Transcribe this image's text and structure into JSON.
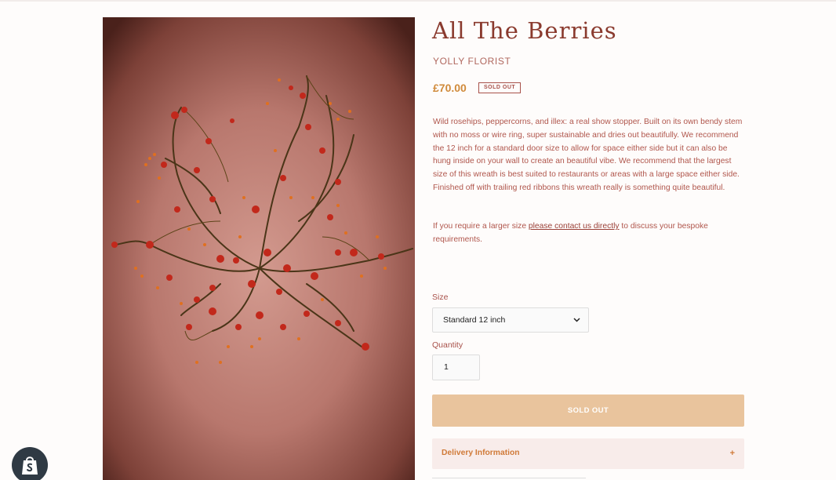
{
  "product": {
    "title": "All The Berries",
    "vendor": "YOLLY FLORIST",
    "price": "£70.00",
    "badge": "SOLD OUT",
    "description": "Wild rosehips, peppercorns, and illex: a real show stopper. Built on its own bendy stem with no moss or wire ring, super sustainable and dries out beautifully. We recommend the 12 inch for a standard door size to allow for space either side but it can also be hung inside on your wall to create an beautiful vibe. We recommend that the largest size of this wreath is best suited to restaurants or areas with a large space either side. Finished off with trailing red ribbons this wreath really is something quite beautiful.",
    "contact_prefix": "If you require a larger size ",
    "contact_link": "please contact us directly",
    "contact_suffix": " to discuss your bespoke requirements."
  },
  "form": {
    "size_label": "Size",
    "size_value": "Standard 12 inch",
    "quantity_label": "Quantity",
    "quantity_value": "1",
    "button_label": "SOLD OUT"
  },
  "accordion": {
    "title": "Delivery Information",
    "icon": "+"
  },
  "icons": {
    "select": "chevron-down-icon",
    "store": "shopify-bag-icon"
  },
  "colors": {
    "accent": "#8a3a2e",
    "price": "#d08a3a",
    "sold_out_button": "#e9c49d",
    "accordion_bg": "#f8ecea"
  }
}
